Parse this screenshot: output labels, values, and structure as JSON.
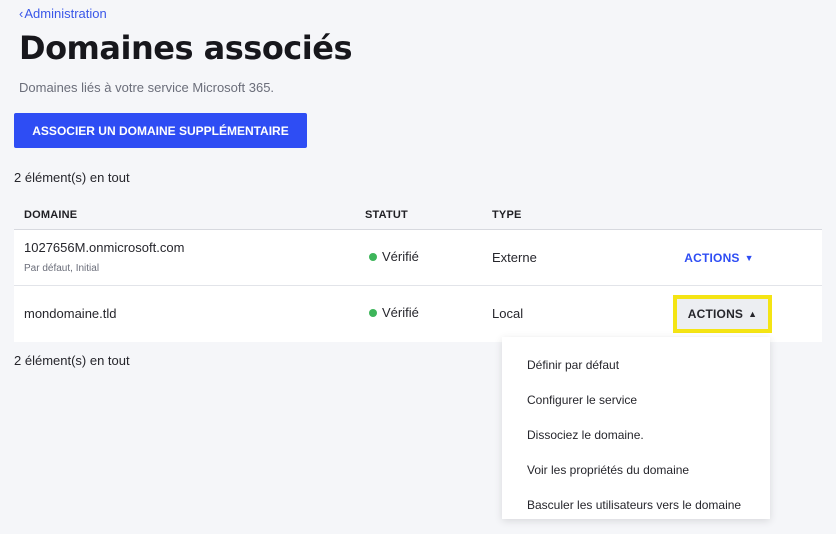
{
  "breadcrumb": {
    "chevron": "‹",
    "label": "Administration"
  },
  "page": {
    "title": "Domaines associés",
    "subtitle": "Domaines liés à votre service Microsoft 365.",
    "primary_button": "ASSOCIER UN DOMAINE SUPPLÉMENTAIRE",
    "count_text": "2 élément(s) en tout"
  },
  "table": {
    "headers": {
      "domain": "DOMAINE",
      "status": "STATUT",
      "type": "TYPE"
    },
    "rows": [
      {
        "domain": "1027656M.onmicrosoft.com",
        "sub": "Par défaut, Initial",
        "status": "Vérifié",
        "type": "Externe",
        "actions": "ACTIONS",
        "caret": "▼"
      },
      {
        "domain": "mondomaine.tld",
        "sub": "",
        "status": "Vérifié",
        "type": "Local",
        "actions": "ACTIONS",
        "caret": "▲"
      }
    ]
  },
  "dropdown": {
    "items": [
      "Définir par défaut",
      "Configurer le service",
      "Dissociez le domaine.",
      "Voir les propriétés du domaine",
      "Basculer les utilisateurs vers le domaine"
    ]
  },
  "colors": {
    "accent": "#2e4df4",
    "status_ok": "#3db55a",
    "highlight": "#f4e414",
    "background": "#f5f6f9"
  },
  "icons": {
    "status": "status-dot-icon",
    "back": "chevron-left-icon",
    "caret_down": "caret-down-icon",
    "caret_up": "caret-up-icon"
  }
}
